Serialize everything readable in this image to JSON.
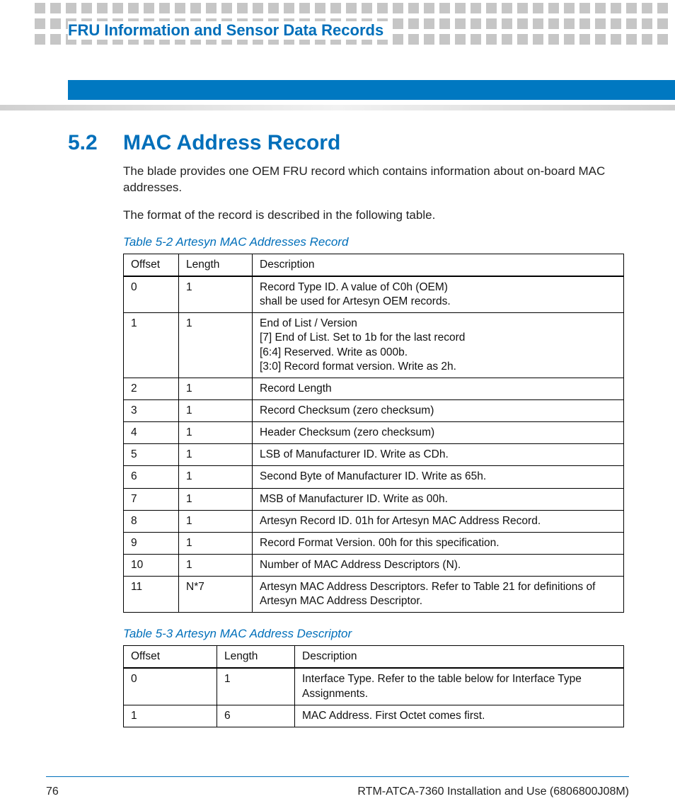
{
  "chapterTitle": "FRU Information and Sensor Data Records",
  "section": {
    "number": "5.2",
    "title": "MAC Address Record"
  },
  "paragraphs": [
    "The blade provides one OEM FRU record which contains information about on-board MAC addresses.",
    "The format of the record is described in the following table."
  ],
  "table1": {
    "caption": "Table 5-2 Artesyn MAC Addresses Record",
    "headers": [
      "Offset",
      "Length",
      "Description"
    ],
    "rows": [
      [
        "0",
        "1",
        "Record Type ID. A value of C0h (OEM)\nshall be used for Artesyn OEM records."
      ],
      [
        "1",
        "1",
        "End of List / Version\n[7] End of List. Set to 1b for the last record\n[6:4] Reserved. Write as 000b.\n[3:0] Record format version. Write as 2h."
      ],
      [
        "2",
        "1",
        "Record Length"
      ],
      [
        "3",
        "1",
        "Record Checksum (zero checksum)"
      ],
      [
        "4",
        "1",
        "Header Checksum (zero checksum)"
      ],
      [
        "5",
        "1",
        "LSB of Manufacturer ID. Write as CDh."
      ],
      [
        "6",
        "1",
        "Second Byte of Manufacturer ID. Write as 65h."
      ],
      [
        "7",
        "1",
        "MSB of Manufacturer ID. Write as 00h."
      ],
      [
        "8",
        "1",
        "Artesyn Record ID. 01h for Artesyn MAC Address Record."
      ],
      [
        "9",
        "1",
        "Record Format Version. 00h for this specification."
      ],
      [
        "10",
        "1",
        "Number of MAC Address Descriptors (N)."
      ],
      [
        "11",
        "N*7",
        "Artesyn MAC Address Descriptors. Refer to Table 21 for definitions of Artesyn MAC Address Descriptor."
      ]
    ]
  },
  "table2": {
    "caption": "Table 5-3 Artesyn MAC Address Descriptor",
    "headers": [
      "Offset",
      "Length",
      "Description"
    ],
    "rows": [
      [
        "0",
        "1",
        "Interface Type. Refer to the table below for Interface Type Assignments."
      ],
      [
        "1",
        "6",
        "MAC Address. First Octet comes first."
      ]
    ]
  },
  "footer": {
    "pageNumber": "76",
    "docTitle": "RTM-ATCA-7360 Installation and Use (6806800J08M)"
  }
}
